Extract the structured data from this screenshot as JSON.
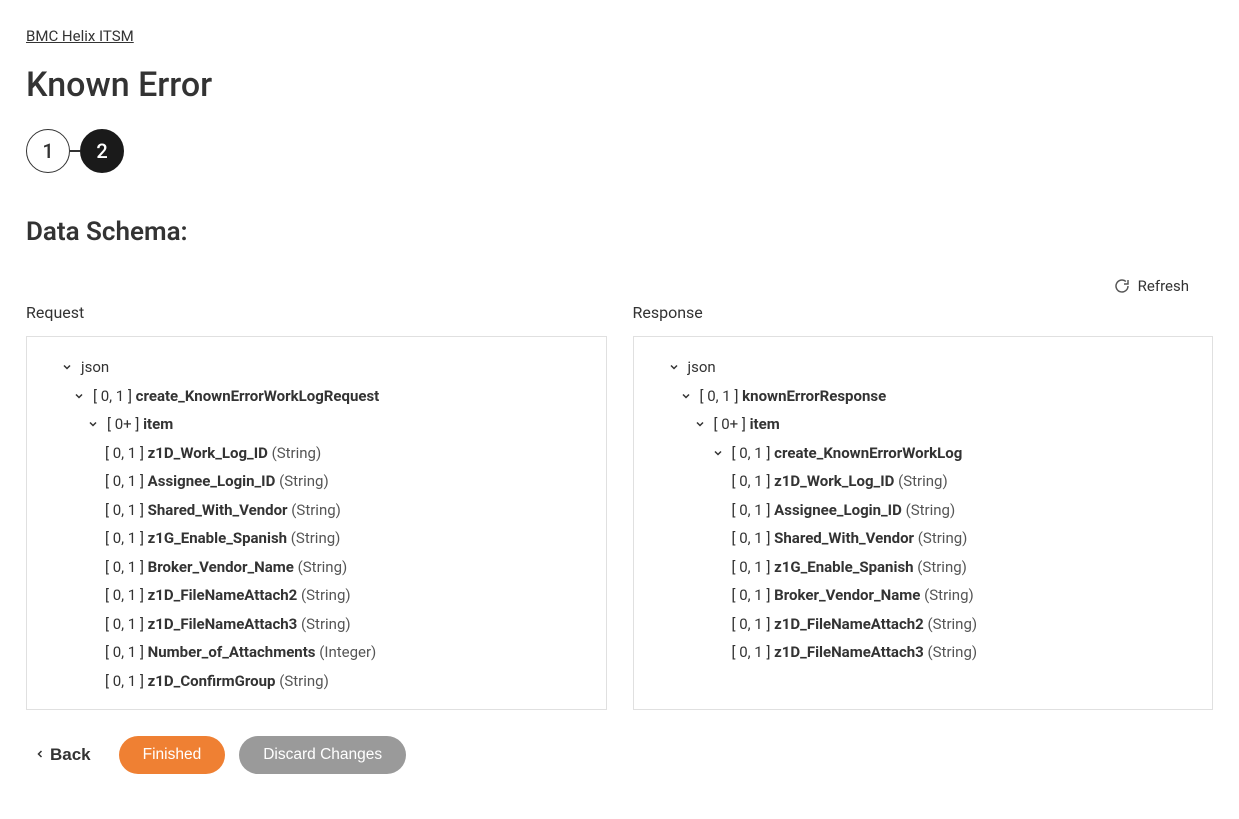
{
  "breadcrumb": "BMC Helix ITSM",
  "pageTitle": "Known Error",
  "stepper": {
    "step1": "1",
    "step2": "2"
  },
  "sectionHeading": "Data Schema:",
  "refresh": "Refresh",
  "columnLabels": {
    "request": "Request",
    "response": "Response"
  },
  "request": {
    "root": "json",
    "node1": {
      "card": "[ 0, 1 ]",
      "name": "create_KnownErrorWorkLogRequest"
    },
    "node2": {
      "card": "[ 0+ ]",
      "name": "item"
    },
    "fields": [
      {
        "card": "[ 0, 1 ]",
        "name": "z1D_Work_Log_ID",
        "type": "(String)"
      },
      {
        "card": "[ 0, 1 ]",
        "name": "Assignee_Login_ID",
        "type": "(String)"
      },
      {
        "card": "[ 0, 1 ]",
        "name": "Shared_With_Vendor",
        "type": "(String)"
      },
      {
        "card": "[ 0, 1 ]",
        "name": "z1G_Enable_Spanish",
        "type": "(String)"
      },
      {
        "card": "[ 0, 1 ]",
        "name": "Broker_Vendor_Name",
        "type": "(String)"
      },
      {
        "card": "[ 0, 1 ]",
        "name": "z1D_FileNameAttach2",
        "type": "(String)"
      },
      {
        "card": "[ 0, 1 ]",
        "name": "z1D_FileNameAttach3",
        "type": "(String)"
      },
      {
        "card": "[ 0, 1 ]",
        "name": "Number_of_Attachments",
        "type": "(Integer)"
      },
      {
        "card": "[ 0, 1 ]",
        "name": "z1D_ConfirmGroup",
        "type": "(String)"
      }
    ]
  },
  "response": {
    "root": "json",
    "node1": {
      "card": "[ 0, 1 ]",
      "name": "knownErrorResponse"
    },
    "node2": {
      "card": "[ 0+ ]",
      "name": "item"
    },
    "node3": {
      "card": "[ 0, 1 ]",
      "name": "create_KnownErrorWorkLog"
    },
    "fields": [
      {
        "card": "[ 0, 1 ]",
        "name": "z1D_Work_Log_ID",
        "type": "(String)"
      },
      {
        "card": "[ 0, 1 ]",
        "name": "Assignee_Login_ID",
        "type": "(String)"
      },
      {
        "card": "[ 0, 1 ]",
        "name": "Shared_With_Vendor",
        "type": "(String)"
      },
      {
        "card": "[ 0, 1 ]",
        "name": "z1G_Enable_Spanish",
        "type": "(String)"
      },
      {
        "card": "[ 0, 1 ]",
        "name": "Broker_Vendor_Name",
        "type": "(String)"
      },
      {
        "card": "[ 0, 1 ]",
        "name": "z1D_FileNameAttach2",
        "type": "(String)"
      },
      {
        "card": "[ 0, 1 ]",
        "name": "z1D_FileNameAttach3",
        "type": "(String)"
      }
    ]
  },
  "footer": {
    "back": "Back",
    "finished": "Finished",
    "discard": "Discard Changes"
  }
}
